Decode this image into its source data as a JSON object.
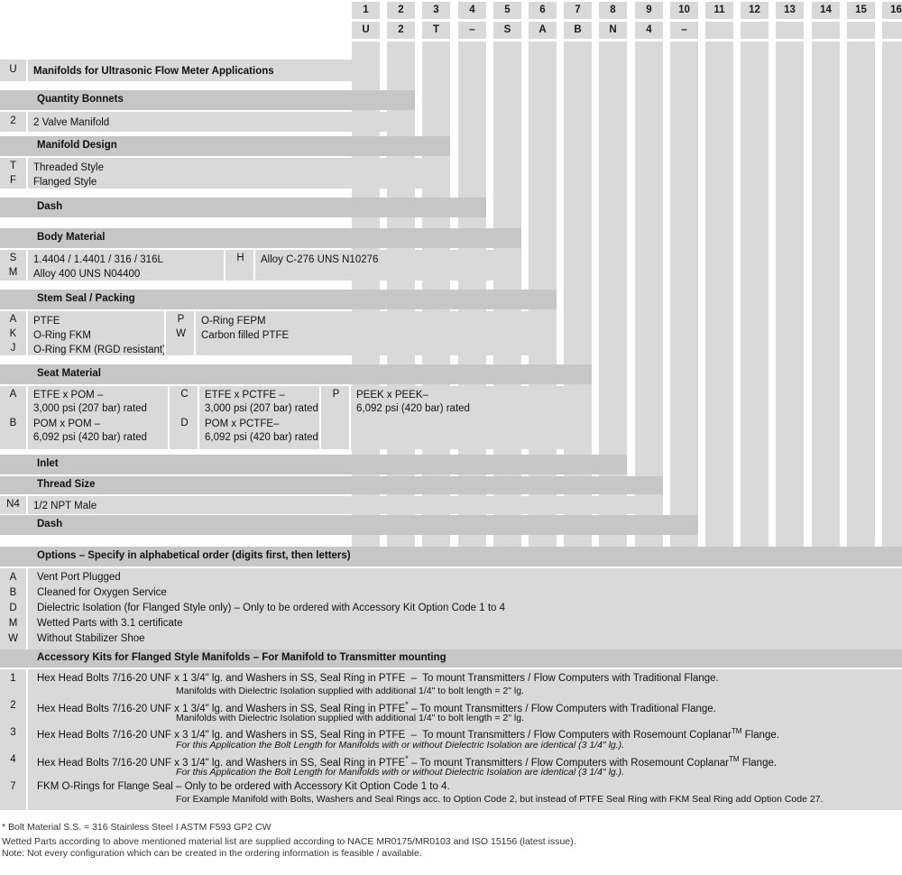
{
  "header": {
    "positions": [
      "1",
      "2",
      "3",
      "4",
      "5",
      "6",
      "7",
      "8",
      "9",
      "10",
      "11",
      "12",
      "13",
      "14",
      "15",
      "16"
    ],
    "example_code": [
      "U",
      "2",
      "T",
      "–",
      "S",
      "A",
      "B",
      "N",
      "4",
      "–",
      "",
      "",
      "",
      "",
      "",
      ""
    ]
  },
  "sections": [
    {
      "id": "product",
      "title": "",
      "rows": [
        {
          "code": "U",
          "text": "Manifolds for Ultrasonic Flow Meter Applications",
          "bold": true
        }
      ]
    },
    {
      "id": "quantity-bonnets",
      "title": "Quantity Bonnets",
      "rows": [
        {
          "code": "2",
          "text": "2 Valve Manifold"
        }
      ]
    },
    {
      "id": "manifold-design",
      "title": "Manifold Design",
      "rows": [
        {
          "code": "T",
          "text": "Threaded Style"
        },
        {
          "code": "F",
          "text": "Flanged Style"
        }
      ]
    },
    {
      "id": "dash-1",
      "title": "Dash",
      "rows": []
    },
    {
      "id": "body-material",
      "title": "Body Material",
      "columns": [
        [
          {
            "code": "S",
            "text": "1.4404 / 1.4401 / 316 / 316L"
          },
          {
            "code": "M",
            "text": "Alloy 400 UNS N04400"
          }
        ],
        [
          {
            "code": "H",
            "text": "Alloy C-276 UNS N10276"
          }
        ]
      ]
    },
    {
      "id": "stem-seal-packing",
      "title": "Stem Seal / Packing",
      "columns": [
        [
          {
            "code": "A",
            "text": "PTFE"
          },
          {
            "code": "K",
            "text": "O-Ring FKM"
          },
          {
            "code": "J",
            "text": "O-Ring FKM (RGD resistant)"
          }
        ],
        [
          {
            "code": "P",
            "text": "O-Ring FEPM"
          },
          {
            "code": "W",
            "text": "Carbon filled PTFE"
          }
        ]
      ]
    },
    {
      "id": "seat-material",
      "title": "Seat Material",
      "columns": [
        [
          {
            "code": "A",
            "text": "ETFE x POM –\n3,000 psi (207 bar) rated"
          },
          {
            "code": "B",
            "text": "POM x POM –\n6,092 psi (420 bar) rated"
          }
        ],
        [
          {
            "code": "C",
            "text": "ETFE x PCTFE –\n3,000 psi (207 bar) rated"
          },
          {
            "code": "D",
            "text": "POM x PCTFE–\n6,092 psi (420 bar) rated"
          }
        ],
        [
          {
            "code": "P",
            "text": "PEEK x PEEK–\n6,092 psi (420 bar) rated"
          }
        ]
      ]
    },
    {
      "id": "inlet",
      "title": "Inlet",
      "rows": []
    },
    {
      "id": "thread-size",
      "title": "Thread Size",
      "rows": [
        {
          "code": "N4",
          "text": "1/2 NPT Male"
        }
      ]
    },
    {
      "id": "dash-2",
      "title": "Dash",
      "rows": []
    }
  ],
  "options": {
    "title": "Options – Specify in alphabetical order (digits first, then letters)",
    "rows": [
      {
        "code": "A",
        "text": "Vent Port Plugged"
      },
      {
        "code": "B",
        "text": "Cleaned for Oxygen Service"
      },
      {
        "code": "D",
        "text": "Dielectric Isolation (for Flanged Style only) – Only to be ordered with Accessory Kit Option Code 1 to 4"
      },
      {
        "code": "M",
        "text": "Wetted Parts with 3.1 certificate"
      },
      {
        "code": "W",
        "text": "Without Stabilizer Shoe"
      }
    ]
  },
  "accessory_kits": {
    "title": "Accessory Kits for Flanged Style Manifolds – For Manifold to Transmitter mounting",
    "rows": [
      {
        "code": "1",
        "line1": "Hex Head Bolts 7/16-20 UNF x 1 3/4\" lg. and Washers in SS, Seal Ring in PTFE  –  To mount Transmitters / Flow Computers with Traditional Flange.",
        "line2": "Manifolds with Dielectric Isolation supplied with additional 1/4\" to bolt length = 2\" lg.",
        "line2_italic": false
      },
      {
        "code": "2",
        "line1_pre": "Hex Head Bolts 7/16-20 UNF x 1 3/4\" lg. and Washers in SS, Seal Ring in PTFE",
        "line1_ast": "*",
        "line1_post": " – To mount Transmitters / Flow Computers with Traditional Flange.",
        "line2": "Manifolds with Dielectric Isolation supplied with additional 1/4\" to bolt length = 2\" lg.",
        "line2_italic": false
      },
      {
        "code": "3",
        "line1_pre": "Hex Head Bolts 7/16-20 UNF x 3 1/4\" lg. and Washers in SS, Seal Ring in PTFE  –  To mount Transmitters / Flow Computers with Rosemount Coplanar",
        "line1_tm": "TM",
        "line1_post": " Flange.",
        "line2": "For this Application the Bolt Length for Manifolds with or without Dielectric Isolation are identical (3 1/4\" lg.).",
        "line2_italic": true
      },
      {
        "code": "4",
        "line1_pre": "Hex Head Bolts 7/16-20 UNF x 3 1/4\" lg. and Washers in SS, Seal Ring in PTFE",
        "line1_ast": "*",
        "line1_mid": " – To mount Transmitters / Flow Computers with Rosemount Coplanar",
        "line1_tm": "TM",
        "line1_post": " Flange.",
        "line2": "For this Application the Bolt Length for Manifolds with or without Dielectric Isolation are identical (3 1/4\" lg.).",
        "line2_italic": true
      },
      {
        "code": "7",
        "line1": "FKM O-Rings for Flange Seal – Only to be ordered with Accessory Kit Option Code 1 to 4.",
        "line2": "For Example Manifold with Bolts, Washers and Seal Rings acc. to Option Code 2, but instead of PTFE Seal Ring with FKM Seal Ring add Option Code 27.",
        "line2_italic": false
      }
    ]
  },
  "footnotes": [
    "* Bolt Material S.S. = 316 Stainless Steel I ASTM F593 GP2 CW",
    "Wetted Parts according to above mentioned material list are supplied according to NACE MR0175/MR0103 and ISO 15156 (latest issue).",
    "Note: Not every configuration which can be created in the ordering information is feasible / available."
  ],
  "colors": {
    "block_fill": "#d9d9d9",
    "title_fill": "#c6c6c6",
    "page_bg": "#ffffff"
  }
}
